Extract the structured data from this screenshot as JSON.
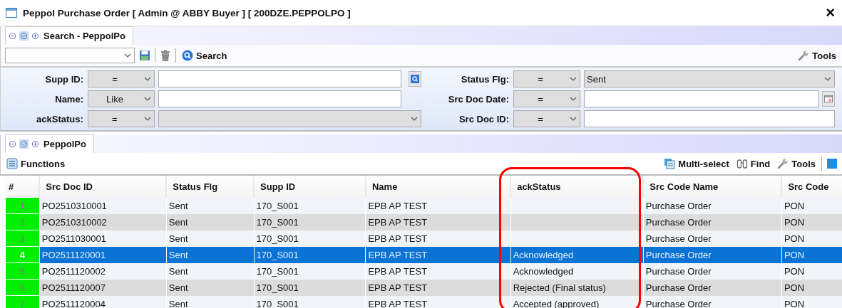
{
  "window": {
    "title": "Peppol Purchase Order [ Admin @ ABBY Buyer ] [ 200DZE.PEPPOLPO ]",
    "close": "×"
  },
  "search_panel": {
    "tab": {
      "label": "Search - PeppolPo",
      "selected": true
    },
    "toolbar": {
      "search_label": "Search",
      "tools_label": "Tools"
    },
    "filters_left": [
      {
        "label": "Supp ID:",
        "operator": "=",
        "kind": "lookup"
      },
      {
        "label": "Name:",
        "operator": "Like",
        "kind": "text"
      },
      {
        "label": "ackStatus:",
        "operator": "=",
        "kind": "select"
      }
    ],
    "filters_right": [
      {
        "label": "Status Flg:",
        "operator": "=",
        "kind": "select",
        "value": "Sent"
      },
      {
        "label": "Src Doc Date:",
        "operator": "=",
        "kind": "date"
      },
      {
        "label": "Src Doc ID:",
        "operator": "=",
        "kind": "text"
      }
    ]
  },
  "list_panel": {
    "tab": {
      "label": "PeppolPo",
      "selected": true
    },
    "toolbar": {
      "functions_label": "Functions",
      "multiselect_label": "Multi-select",
      "find_label": "Find",
      "tools_label": "Tools"
    },
    "table": {
      "columns": [
        {
          "label": "#",
          "circled": false
        },
        {
          "label": "Src Doc ID",
          "circled": false
        },
        {
          "label": "Status Flg",
          "circled": false
        },
        {
          "label": "Supp ID",
          "circled": false
        },
        {
          "label": "Name",
          "circled": false
        },
        {
          "label": "ackStatus",
          "circled": true
        },
        {
          "label": "Src Code Name",
          "circled": false
        },
        {
          "label": "Src Code",
          "circled": false
        }
      ],
      "rows": [
        {
          "cells": [
            "1",
            "PO2510310001",
            "Sent",
            "170_S001",
            "EPB AP TEST",
            "",
            "Purchase Order",
            "PON"
          ],
          "selected": false
        },
        {
          "cells": [
            "2",
            "PO2510310002",
            "Sent",
            "170_S001",
            "EPB AP TEST",
            "",
            "Purchase Order",
            "PON"
          ],
          "selected": false
        },
        {
          "cells": [
            "3",
            "PO2511030001",
            "Sent",
            "170_S001",
            "EPB AP TEST",
            "",
            "Purchase Order",
            "PON"
          ],
          "selected": false
        },
        {
          "cells": [
            "4",
            "PO2511120001",
            "Sent",
            "170_S001",
            "EPB AP TEST",
            "Acknowledged",
            "Purchase Order",
            "PON"
          ],
          "selected": true
        },
        {
          "cells": [
            "5",
            "PO2511120002",
            "Sent",
            "170_S001",
            "EPB AP TEST",
            "Acknowledged",
            "Purchase Order",
            "PON"
          ],
          "selected": false
        },
        {
          "cells": [
            "6",
            "PO2511120007",
            "Sent",
            "170_S001",
            "EPB AP TEST",
            "Rejected (Final status)",
            "Purchase Order",
            "PON"
          ],
          "selected": false
        },
        {
          "cells": [
            "7",
            "PO2511120004",
            "Sent",
            "170_S001",
            "EPB AP TEST",
            "Accepted (approved)",
            "Purchase Order",
            "PON"
          ],
          "selected": false
        }
      ]
    }
  }
}
